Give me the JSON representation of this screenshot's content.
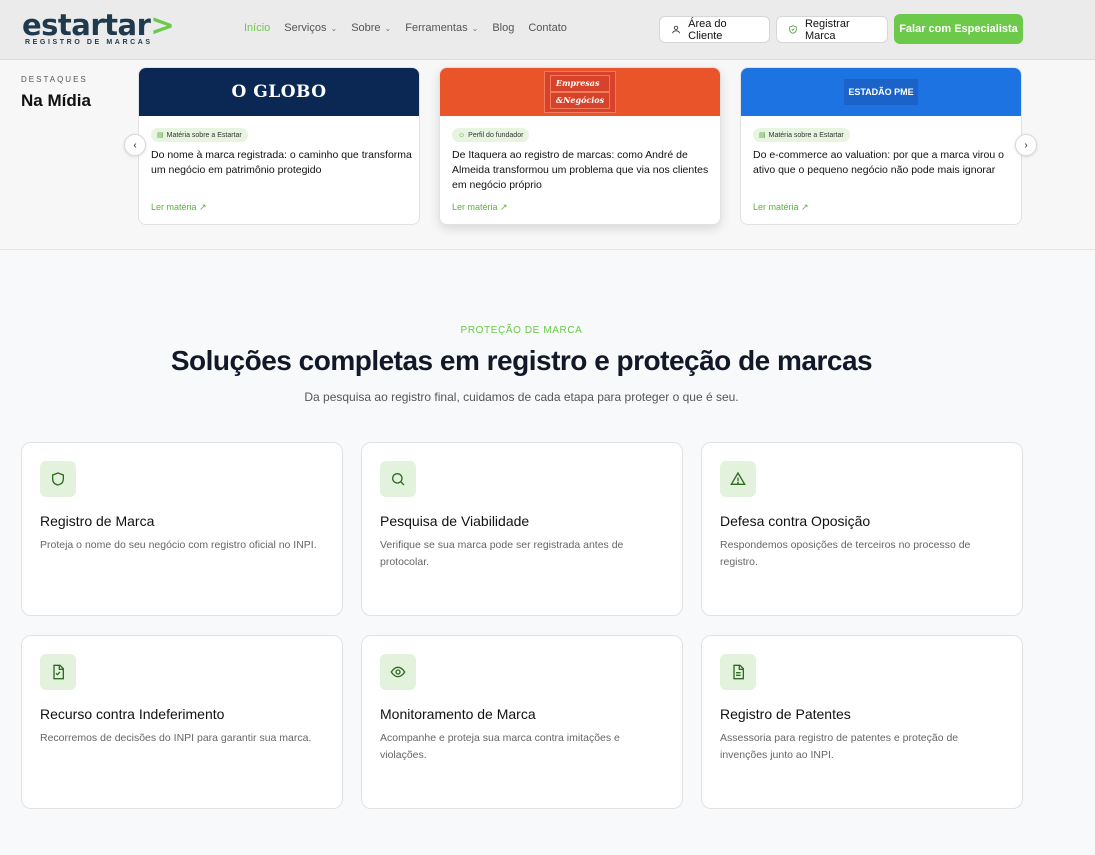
{
  "header": {
    "logo_main": "estartar",
    "logo_accent": ">",
    "logo_tagline": "REGISTRO DE MARCAS",
    "nav": [
      {
        "label": "Início",
        "active": true,
        "dropdown": false
      },
      {
        "label": "Serviços",
        "active": false,
        "dropdown": true
      },
      {
        "label": "Sobre",
        "active": false,
        "dropdown": true
      },
      {
        "label": "Ferramentas",
        "active": false,
        "dropdown": true
      },
      {
        "label": "Blog",
        "active": false,
        "dropdown": false
      },
      {
        "label": "Contato",
        "active": false,
        "dropdown": false
      }
    ],
    "client_area_label": "Área do Cliente",
    "register_brand_label": "Registrar Marca",
    "specialist_label": "Falar com Especialista"
  },
  "media": {
    "eyebrow": "DESTAQUES",
    "title": "Na Mídia",
    "cards": [
      {
        "outlet": "O GLOBO",
        "tag": "Matéria sobre a Estartar",
        "tag_icon": "newspaper-icon",
        "text": "Do nome à marca registrada: o caminho que transforma um negócio em patrimônio protegido",
        "link": "Ler matéria ↗"
      },
      {
        "outlet_line1": "Empresas",
        "outlet_line2": "&Negócios",
        "tag": "Perfil do fundador",
        "tag_icon": "user-icon",
        "text": "De Itaquera ao registro de marcas: como André de Almeida transformou um problema que via nos clientes em negócio próprio",
        "link": "Ler matéria ↗"
      },
      {
        "outlet": "ESTADÃO PME",
        "tag": "Matéria sobre a Estartar",
        "tag_icon": "newspaper-icon",
        "text": "Do e-commerce ao valuation: por que a marca virou o ativo que o pequeno negócio não pode mais ignorar",
        "link": "Ler matéria ↗"
      }
    ]
  },
  "solutions": {
    "eyebrow": "PROTEÇÃO DE MARCA",
    "title": "Soluções completas em registro e proteção de marcas",
    "subtitle": "Da pesquisa ao registro final, cuidamos de cada etapa para proteger o que é seu.",
    "cards": [
      {
        "icon": "shield-icon",
        "title": "Registro de Marca",
        "desc": "Proteja o nome do seu negócio com registro oficial no INPI."
      },
      {
        "icon": "search-icon",
        "title": "Pesquisa de Viabilidade",
        "desc": "Verifique se sua marca pode ser registrada antes de protocolar."
      },
      {
        "icon": "warning-icon",
        "title": "Defesa contra Oposição",
        "desc": "Respondemos oposições de terceiros no processo de registro."
      },
      {
        "icon": "file-check-icon",
        "title": "Recurso contra Indeferimento",
        "desc": "Recorremos de decisões do INPI para garantir sua marca."
      },
      {
        "icon": "eye-icon",
        "title": "Monitoramento de Marca",
        "desc": "Acompanhe e proteja sua marca contra imitações e violações."
      },
      {
        "icon": "document-icon",
        "title": "Registro de Patentes",
        "desc": "Assessoria para registro de patentes e proteção de invenções junto ao INPI."
      }
    ]
  },
  "colors": {
    "brand_green": "#6cc94a",
    "brand_navy": "#1e3a4c",
    "globo_blue": "#0b2754",
    "pegn_orange": "#e9542a",
    "estadao_blue": "#1e73e3"
  }
}
